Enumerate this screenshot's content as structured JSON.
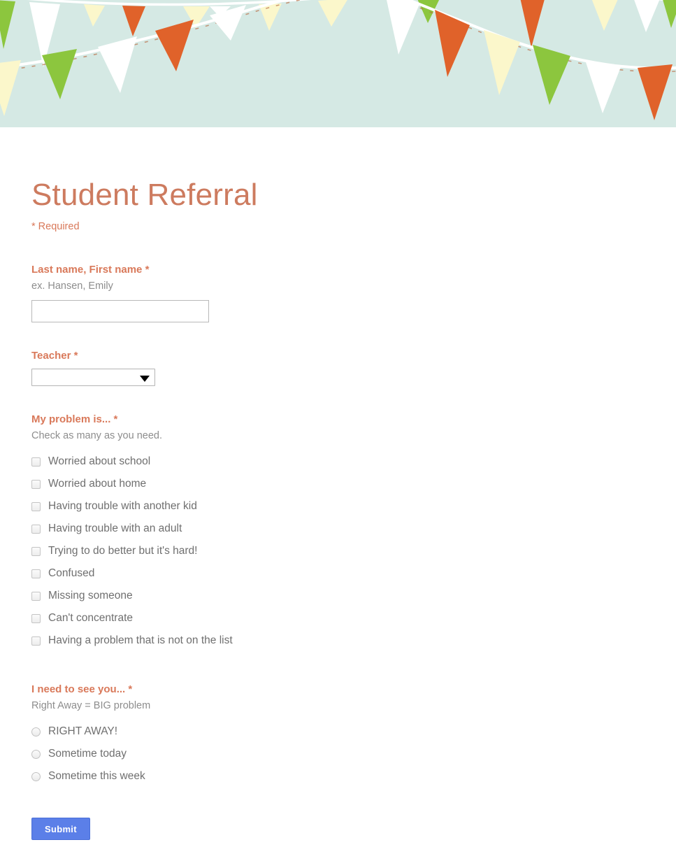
{
  "banner": {
    "name": "bunting-banner",
    "background_color": "#d5e9e4",
    "flag_colors": [
      "#e0622a",
      "#8cc63e",
      "#ffffff",
      "#fbf7cb"
    ],
    "string_color": "#ffffff"
  },
  "form": {
    "title": "Student Referral",
    "required_note": "* Required",
    "accent_color": "#d9795a",
    "title_color": "#cd7b5f",
    "fields": [
      {
        "id": "name",
        "label": "Last name, First name",
        "required_marker": "*",
        "help": "ex. Hansen, Emily",
        "type": "text",
        "value": "",
        "placeholder": ""
      },
      {
        "id": "teacher",
        "label": "Teacher",
        "required_marker": "*",
        "help": "",
        "type": "select",
        "selected": "",
        "options": [
          ""
        ]
      },
      {
        "id": "problem",
        "label": "My problem is...",
        "required_marker": "*",
        "help": "Check as many as you need.",
        "type": "checkbox",
        "options": [
          "Worried about school",
          "Worried about home",
          "Having trouble with another kid",
          "Having trouble with an adult",
          "Trying to do better but it's hard!",
          "Confused",
          "Missing someone",
          "Can't concentrate",
          "Having a problem that is not on the list"
        ]
      },
      {
        "id": "urgency",
        "label": "I need to see you...",
        "required_marker": "*",
        "help": "Right Away = BIG problem",
        "type": "radio",
        "options": [
          "RIGHT AWAY!",
          "Sometime today",
          "Sometime this week"
        ]
      }
    ],
    "submit_label": "Submit",
    "submit_color": "#5b7fe8"
  }
}
